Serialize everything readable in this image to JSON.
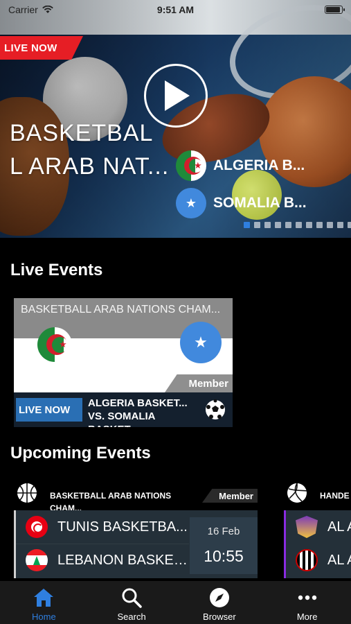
{
  "status_bar": {
    "carrier": "Carrier",
    "time": "9:51 AM"
  },
  "hero": {
    "live_badge": "LIVE NOW",
    "title": "BASKETBAL L ARAB NAT...",
    "teams": [
      {
        "name": "ALGERIA B...",
        "flag": "algeria-flag"
      },
      {
        "name": "SOMALIA B...",
        "flag": "somalia-flag"
      }
    ],
    "page_count": 11,
    "active_page": 1
  },
  "live_events": {
    "title": "Live Events",
    "cards": [
      {
        "league": "BASKETBALL ARAB NATIONS CHAM...",
        "member_tag": "Member",
        "live_badge": "LIVE NOW",
        "match": "ALGERIA BASKET... VS. SOMALIA BASKET...",
        "sport_icon": "soccer-ball-icon"
      }
    ]
  },
  "upcoming_events": {
    "title": "Upcoming Events",
    "cards": [
      {
        "sport_icon": "basketball-icon",
        "league": "BASKETBALL ARAB NATIONS CHAM...",
        "member_tag": "Member",
        "team1": "TUNIS BASKETBA...",
        "team2": "LEBANON BASKET...",
        "date": "16 Feb",
        "time": "10:55",
        "accent": "#d0d0d0"
      },
      {
        "sport_icon": "volleyball-icon",
        "league": "HANDE",
        "team1": "AL A",
        "team2": "AL A",
        "accent": "#8a2be2"
      }
    ]
  },
  "tab_bar": {
    "items": [
      {
        "label": "Home",
        "icon": "home-icon",
        "active": true
      },
      {
        "label": "Search",
        "icon": "search-icon",
        "active": false
      },
      {
        "label": "Browser",
        "icon": "compass-icon",
        "active": false
      },
      {
        "label": "More",
        "icon": "more-icon",
        "active": false
      }
    ]
  },
  "colors": {
    "accent": "#2f7fe0",
    "live_red": "#e61e25",
    "card_dark": "#243039"
  }
}
